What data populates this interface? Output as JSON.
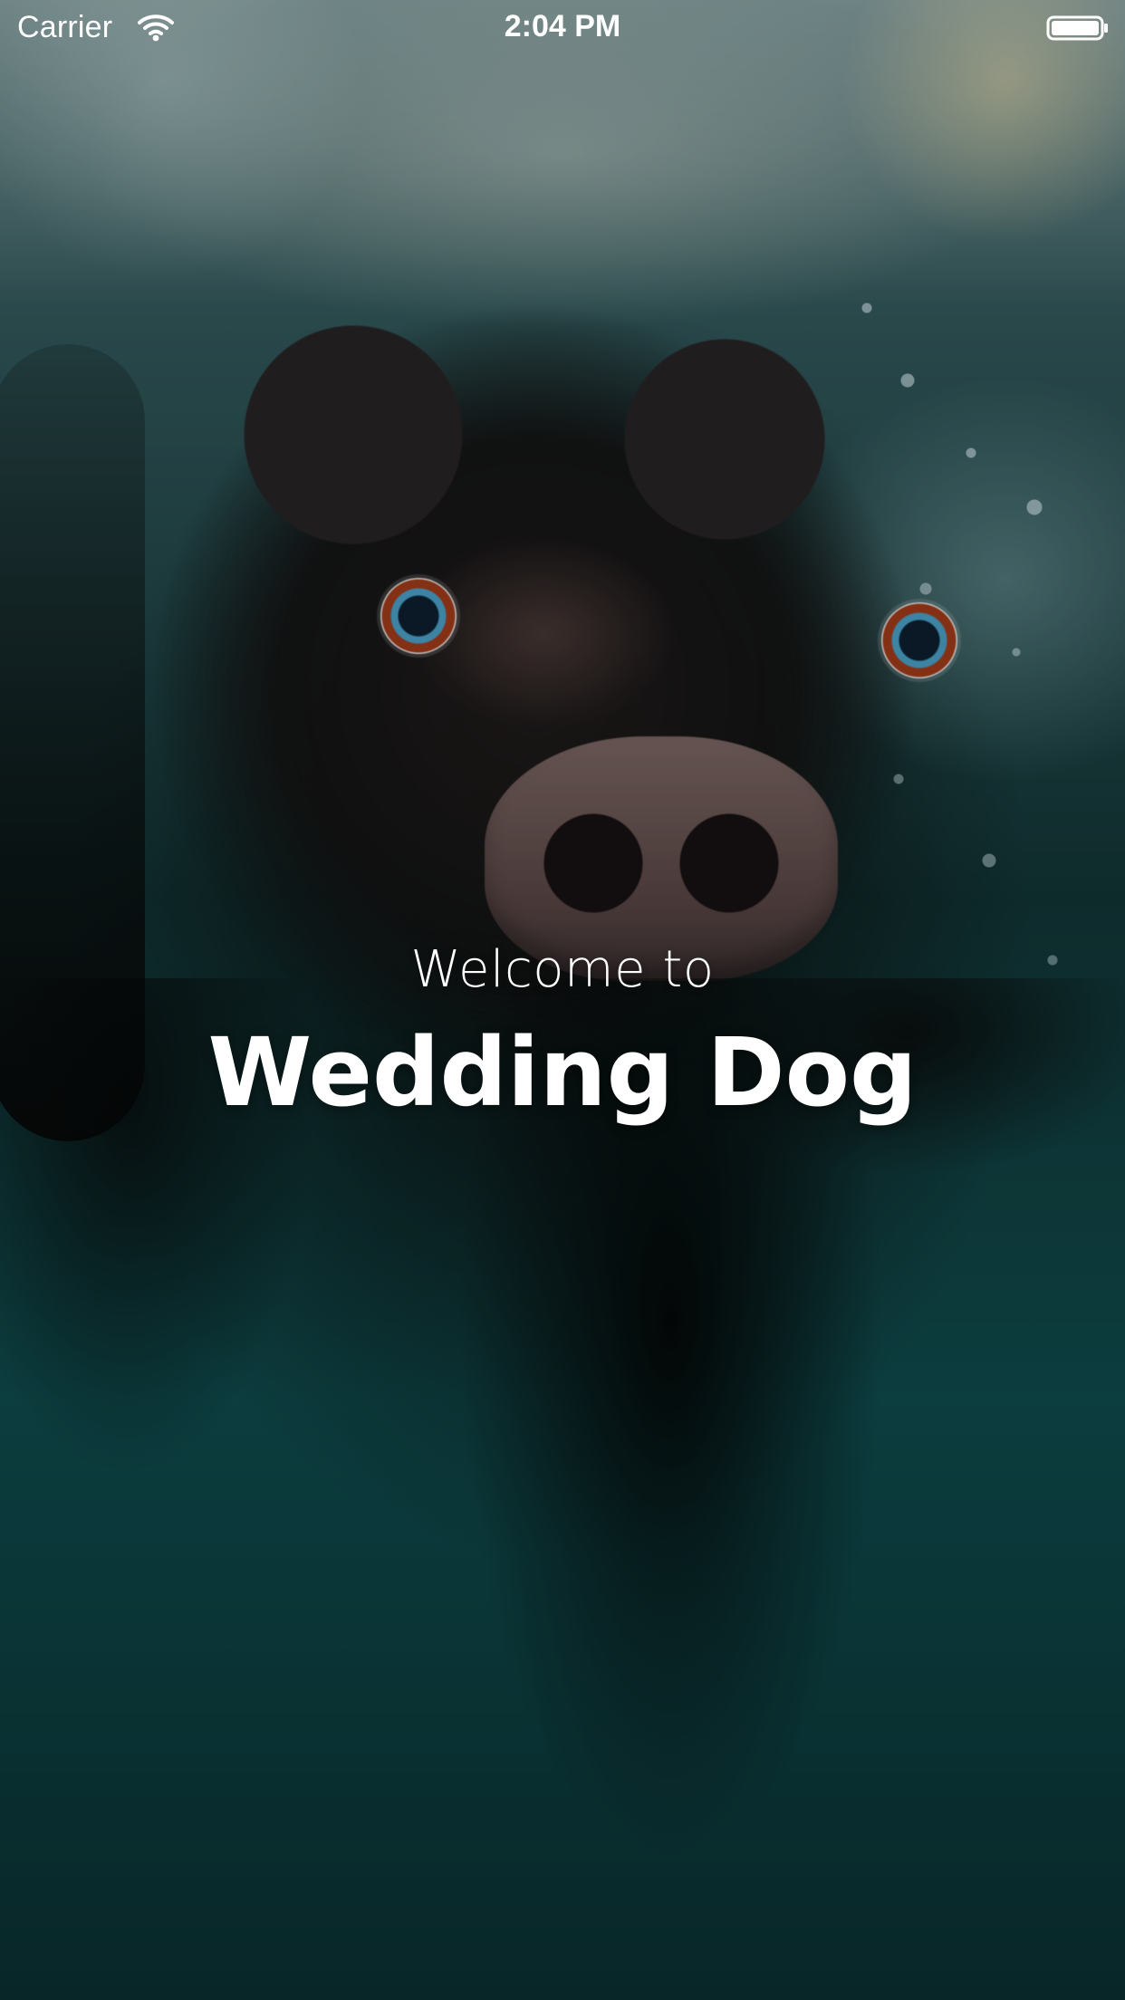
{
  "status_bar": {
    "carrier": "Carrier",
    "time": "2:04 PM",
    "icons": {
      "wifi": "wifi-icon",
      "battery": "battery-icon"
    }
  },
  "hero": {
    "subtitle": "Welcome to",
    "title": "Wedding Dog"
  },
  "background": {
    "image": "underwater-dog-photo",
    "accent_colors": {
      "water": "#0f4b4d",
      "dog": "#141414",
      "text": "#ffffff"
    }
  }
}
